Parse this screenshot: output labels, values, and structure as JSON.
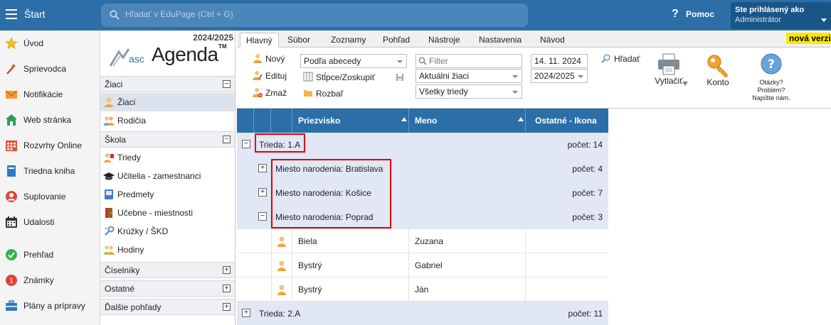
{
  "topbar": {
    "start_label": "Štart",
    "search_placeholder": "Hľadať v EduPage (Ctrl + G)",
    "help_label": "Pomoc",
    "user_line1": "Ste prihlásený ako",
    "user_line2": "Administrátor"
  },
  "leftnav": {
    "items": [
      {
        "label": "Úvod",
        "icon": "star-icon"
      },
      {
        "label": "Sprievodca",
        "icon": "wand-icon"
      },
      {
        "label": "Notifikácie",
        "icon": "envelope-icon"
      },
      {
        "label": "Web stránka",
        "icon": "home-icon"
      },
      {
        "label": "Rozvrhy Online",
        "icon": "calendar-grid-icon"
      },
      {
        "label": "Triedna kniha",
        "icon": "book-icon"
      },
      {
        "label": "Suplovanie",
        "icon": "person-red-icon"
      },
      {
        "label": "Udalosti",
        "icon": "calendar-icon"
      },
      {
        "label": "Prehľad",
        "icon": "check-circle-icon"
      },
      {
        "label": "Známky",
        "icon": "grade-icon"
      },
      {
        "label": "Plány a prípravy",
        "icon": "briefcase-icon"
      }
    ]
  },
  "sidebar2": {
    "year": "2024/2025",
    "logo_asc": "asc",
    "logo_agenda": "Agenda",
    "logo_tm": "TM",
    "sections": [
      {
        "label": "Žiaci",
        "toggle": "−",
        "items": [
          "Žiaci",
          "Rodičia"
        ]
      },
      {
        "label": "Škola",
        "toggle": "−",
        "items": [
          "Triedy",
          "Učitelia - zamestnanci",
          "Predmety",
          "Učebne - miestnosti",
          "Krúžky / ŠKD",
          "Hodiny"
        ]
      },
      {
        "label": "Číselníky",
        "toggle": "+"
      },
      {
        "label": "Ostatné",
        "toggle": "+"
      },
      {
        "label": "Ďalšie pohľady",
        "toggle": "+"
      }
    ]
  },
  "ribbon": {
    "tabs": [
      "Hlavný",
      "Súbor",
      "Zoznamy",
      "Pohľad",
      "Nástroje",
      "Nastavenia",
      "Návod"
    ],
    "nova": "nová verzia",
    "new": "Nový",
    "edit": "Edituj",
    "delete": "Zmaž",
    "sort_combo": "Podľa abecedy",
    "columns": "Stĺpce/Zoskupiť",
    "expand": "Rozbaľ",
    "filter_placeholder": "Filter",
    "students_combo": "Aktuálni žiaci",
    "classes_combo": "Všetky triedy",
    "date": "14. 11. 2024",
    "year_combo": "2024/2025",
    "search": "Hľadať",
    "print": "Vytlačiť",
    "contact": "Konto",
    "help_text": [
      "Otázky?",
      "Problém?",
      "Napíšte nám."
    ]
  },
  "grid": {
    "headers": {
      "surname": "Priezvisko",
      "name": "Meno",
      "other": "Ostatné - Ikona"
    },
    "groups": [
      {
        "label": "Trieda: 1.A",
        "count": "počet: 14",
        "toggle": "−"
      },
      {
        "label": "Miesto narodenia: Bratislava",
        "count": "počet: 4",
        "toggle": "+"
      },
      {
        "label": "Miesto narodenia: Košice",
        "count": "počet: 7",
        "toggle": "+"
      },
      {
        "label": "Miesto narodenia: Poprad",
        "count": "počet: 3",
        "toggle": "−"
      },
      {
        "label": "Trieda: 2.A",
        "count": "počet: 11",
        "toggle": "+"
      }
    ],
    "rows": [
      {
        "surname": "Biela",
        "name": "Zuzana"
      },
      {
        "surname": "Bystrý",
        "name": "Gabriel"
      },
      {
        "surname": "Bystrý",
        "name": "Ján"
      }
    ]
  },
  "colors": {
    "topbar": "#2c6ea7",
    "group_row": "#e2e7f5",
    "highlight": "#e00000",
    "nova_bg": "#ffe800"
  }
}
